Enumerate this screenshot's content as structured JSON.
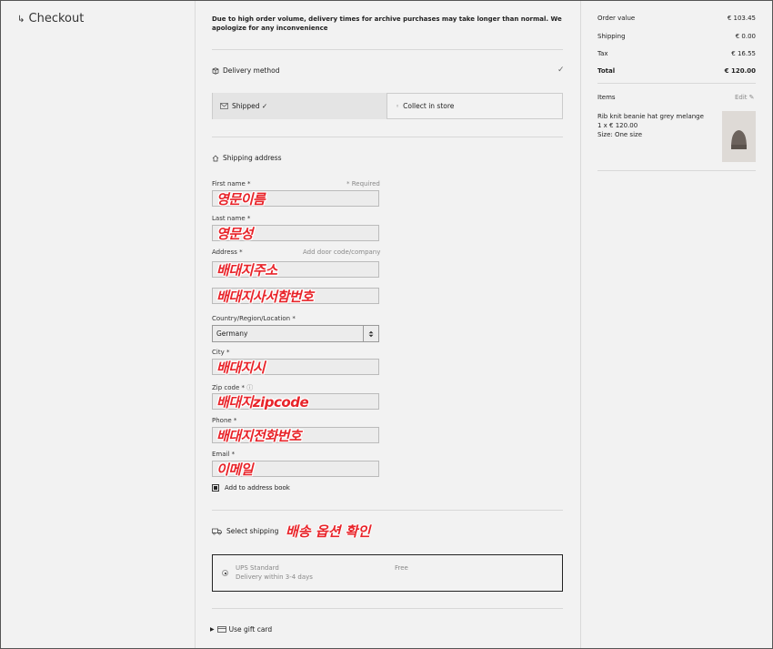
{
  "header": {
    "title": "Checkout",
    "back_glyph": "↳"
  },
  "notice": "Due to high order volume, delivery times for archive purchases may take longer than normal. We apologize for any inconvenience",
  "delivery": {
    "section_title": "Delivery method",
    "check": "✓",
    "options": [
      {
        "label": "Shipped ✓",
        "selected": true
      },
      {
        "label": "Collect in store",
        "selected": false
      }
    ]
  },
  "address": {
    "section_title": "Shipping address",
    "required_note": "* Required",
    "first_name": {
      "label": "First name",
      "req": "*",
      "value": "영문이름"
    },
    "last_name": {
      "label": "Last name",
      "req": "*",
      "value": "영문성"
    },
    "address": {
      "label": "Address",
      "req": "*",
      "extra_link": "Add door code/company",
      "value": "배대지주소"
    },
    "address2": {
      "value": "배대지사서함번호"
    },
    "country": {
      "label": "Country/Region/Location",
      "req": "*",
      "value": "Germany"
    },
    "city": {
      "label": "City",
      "req": "*",
      "value": "배대지시"
    },
    "zip": {
      "label": "Zip code",
      "req": "*",
      "info_glyph": "ⓘ",
      "value": "배대지zipcode"
    },
    "phone": {
      "label": "Phone",
      "req": "*",
      "value": "배대지전화번호"
    },
    "email": {
      "label": "Email",
      "req": "*",
      "value": "이메일"
    },
    "address_book": "Add to address book"
  },
  "shipping": {
    "section_title": "Select shipping",
    "annotation": "배송 옵션 확인",
    "option": {
      "name": "UPS Standard",
      "desc": "Delivery within 3-4 days",
      "price": "Free"
    }
  },
  "gift_card": {
    "label": "Use gift card"
  },
  "summary": {
    "rows": [
      {
        "label": "Order value",
        "value": "€ 103.45"
      },
      {
        "label": "Shipping",
        "value": "€ 0.00"
      },
      {
        "label": "Tax",
        "value": "€ 16.55"
      }
    ],
    "total": {
      "label": "Total",
      "value": "€ 120.00"
    }
  },
  "items": {
    "title": "Items",
    "edit": "Edit",
    "list": [
      {
        "name": "Rib knit beanie hat grey melange",
        "qty_price": "1 x € 120.00",
        "size": "Size: One size"
      }
    ]
  },
  "colors": {
    "annotation": "#e8242a",
    "background": "#f2f2f2"
  }
}
